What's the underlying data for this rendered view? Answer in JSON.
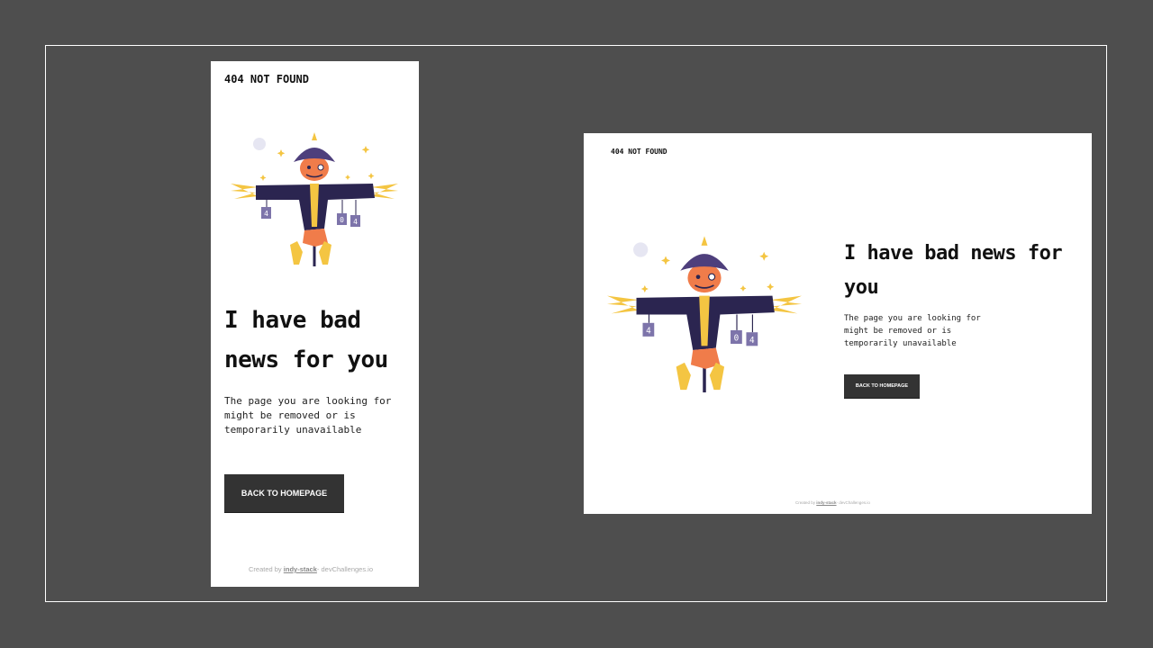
{
  "brand": "404 NOT FOUND",
  "headline": "I have bad news for you",
  "description": "The page you are looking for might be removed or is temporarily unavailable",
  "button_label": "BACK TO HOMEPAGE",
  "footer": {
    "prefix": "Created by",
    "author": "indy-stack",
    "suffix": "- devChallenges.io"
  },
  "illustration": {
    "icon": "scarecrow-illustration",
    "tag_texts": [
      "4",
      "0",
      "4"
    ]
  },
  "colors": {
    "background": "#4e4e4e",
    "page": "#ffffff",
    "button": "#333333",
    "text": "#111111",
    "coat": "#2b2550",
    "hat": "#4e3f7c",
    "face": "#f07c4a",
    "straw": "#f4c542",
    "tag": "#7d74aa"
  }
}
